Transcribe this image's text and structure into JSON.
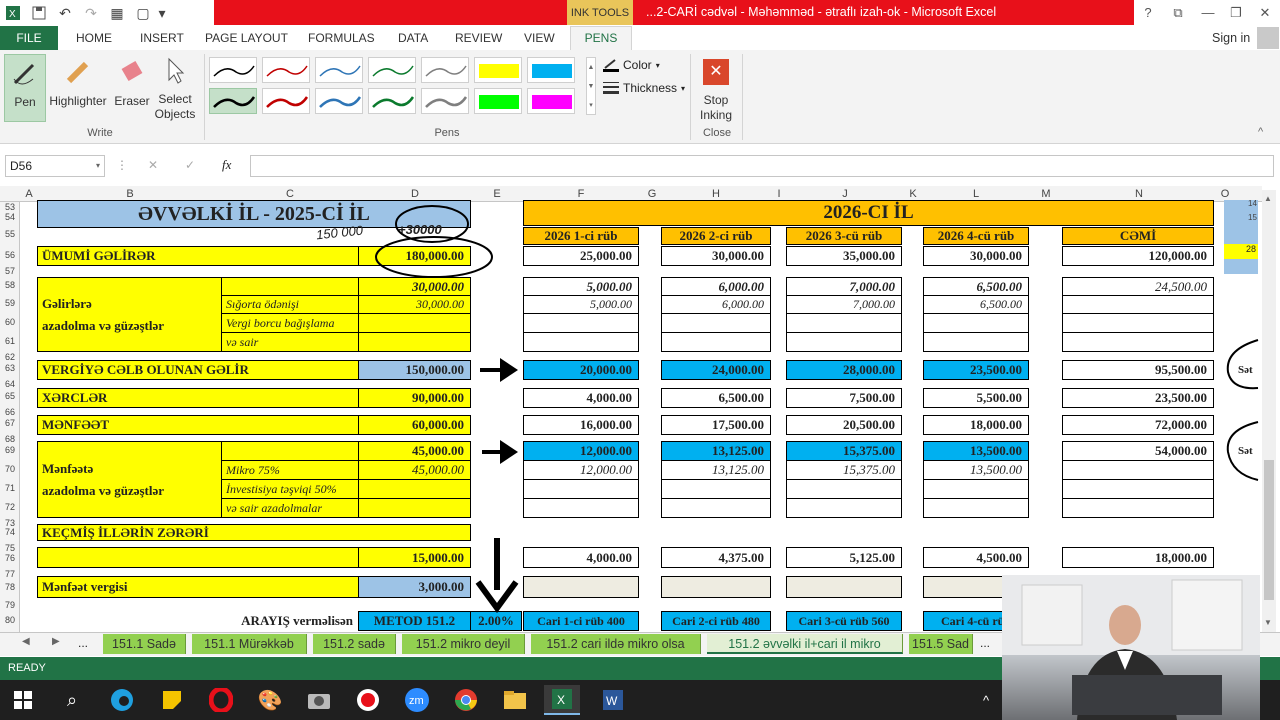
{
  "window": {
    "title": "...2-CARİ cədvəl - Məhəmməd - ətraflı izah-ok - Microsoft Excel",
    "ink_tools": "INK TOOLS"
  },
  "tabs": [
    "FILE",
    "HOME",
    "INSERT",
    "PAGE LAYOUT",
    "FORMULAS",
    "DATA",
    "REVIEW",
    "VIEW",
    "PENS"
  ],
  "signin": "Sign in",
  "ribbon": {
    "write": {
      "pen": "Pen",
      "highlighter": "Highlighter",
      "eraser": "Eraser",
      "select1": "Select",
      "select2": "Objects",
      "label": "Write"
    },
    "pens_label": "Pens",
    "color": "Color",
    "thickness": "Thickness",
    "stop1": "Stop",
    "stop2": "Inking",
    "close_label": "Close",
    "pen_colors": [
      "#000000",
      "#c00000",
      "#2e75b6",
      "#0b7a2d",
      "#7f7f7f",
      "#ffff00",
      "#00b0f0",
      "#000000",
      "#c00000",
      "#2e75b6",
      "#0b7a2d",
      "#7f7f7f",
      "#00ff00",
      "#ff00ff"
    ]
  },
  "namebox": "D56",
  "fx": "fx",
  "columns": [
    "A",
    "B",
    "C",
    "D",
    "E",
    "F",
    "G",
    "H",
    "I",
    "J",
    "K",
    "L",
    "M",
    "N",
    "O"
  ],
  "rows": [
    "53",
    "54",
    "55",
    "56",
    "57",
    "58",
    "59",
    "60",
    "61",
    "62",
    "63",
    "64",
    "65",
    "66",
    "67",
    "68",
    "69",
    "70",
    "71",
    "72",
    "73",
    "74",
    "75",
    "76",
    "77",
    "78",
    "79",
    "80"
  ],
  "sheet": {
    "title_left": "ƏVVƏLKİ İL - 2025-Cİ İL",
    "title_right": "2026-CI İL",
    "handwrite1": "150 000",
    "handwrite2": "+30000",
    "q": [
      "2026 1-ci rüb",
      "2026 2-ci rüb",
      "2026 3-cü rüb",
      "2026 4-cü rüb",
      "CƏMİ"
    ],
    "r56": {
      "label": "ÜMUMİ GƏLİRƏR",
      "d": "180,000.00",
      "f": "25,000.00",
      "h": "30,000.00",
      "j": "35,000.00",
      "l": "30,000.00",
      "n": "120,000.00"
    },
    "r58": {
      "label1": "Gəlirlərə",
      "label2": "azadolma və güzəştlər",
      "d": "30,000.00",
      "f": "5,000.00",
      "h": "6,000.00",
      "j": "7,000.00",
      "l": "6,500.00",
      "n": "24,500.00"
    },
    "r59": {
      "c": "Sığorta ödənişi",
      "d": "30,000.00",
      "f": "5,000.00",
      "h": "6,000.00",
      "j": "7,000.00",
      "l": "6,500.00"
    },
    "r60": {
      "c": "Vergi borcu bağışlama"
    },
    "r61": {
      "c": "və sair"
    },
    "r63": {
      "label": "VERGİYƏ CƏLB OLUNAN GƏLİR",
      "d": "150,000.00",
      "f": "20,000.00",
      "h": "24,000.00",
      "j": "28,000.00",
      "l": "23,500.00",
      "n": "95,500.00"
    },
    "r65": {
      "label": "XƏRCLƏR",
      "d": "90,000.00",
      "f": "4,000.00",
      "h": "6,500.00",
      "j": "7,500.00",
      "l": "5,500.00",
      "n": "23,500.00"
    },
    "r67": {
      "label": "MƏNFƏƏT",
      "d": "60,000.00",
      "f": "16,000.00",
      "h": "17,500.00",
      "j": "20,500.00",
      "l": "18,000.00",
      "n": "72,000.00"
    },
    "r69": {
      "label1": "Mənfəətə",
      "label2": "azadolma və güzəştlər",
      "d": "45,000.00",
      "f": "12,000.00",
      "h": "13,125.00",
      "j": "15,375.00",
      "l": "13,500.00",
      "n": "54,000.00"
    },
    "r70": {
      "c": "Mikro 75%",
      "d": "45,000.00",
      "f": "12,000.00",
      "h": "13,125.00",
      "j": "15,375.00",
      "l": "13,500.00"
    },
    "r71": {
      "c": "İnvestisiya təşviqi 50%"
    },
    "r72": {
      "c": "və sair azadolmalar"
    },
    "r74": {
      "label": "KEÇMİŞ İLLƏRİN ZƏRƏRİ"
    },
    "r76": {
      "d": "15,000.00",
      "f": "4,000.00",
      "h": "4,375.00",
      "j": "5,125.00",
      "l": "4,500.00",
      "n": "18,000.00"
    },
    "r78": {
      "label": "Mənfəət vergisi",
      "d": "3,000.00"
    },
    "r80": {
      "c": "ARAYIŞ verməlisən",
      "d": "METOD 151.2",
      "e": "2.00%",
      "f": "Cari 1-ci rüb 400",
      "h": "Cari 2-ci rüb 480",
      "j": "Cari 3-cü rüb 560",
      "l": "Cari 4-cü rüb"
    },
    "side": {
      "o53": "14",
      "o54": "15",
      "o55": "28",
      "p63": "Sət",
      "p69": "Sət"
    }
  },
  "sheet_tabs": [
    "...",
    "151.1 Sadə",
    "151.1 Mürəkkəb",
    "151.2 sadə",
    "151.2 mikro deyil",
    "151.2 cari ildə mikro olsa",
    "151.2 əvvəlki il+cari il mikro",
    "151.5 Sad",
    "..."
  ],
  "status": "READY"
}
